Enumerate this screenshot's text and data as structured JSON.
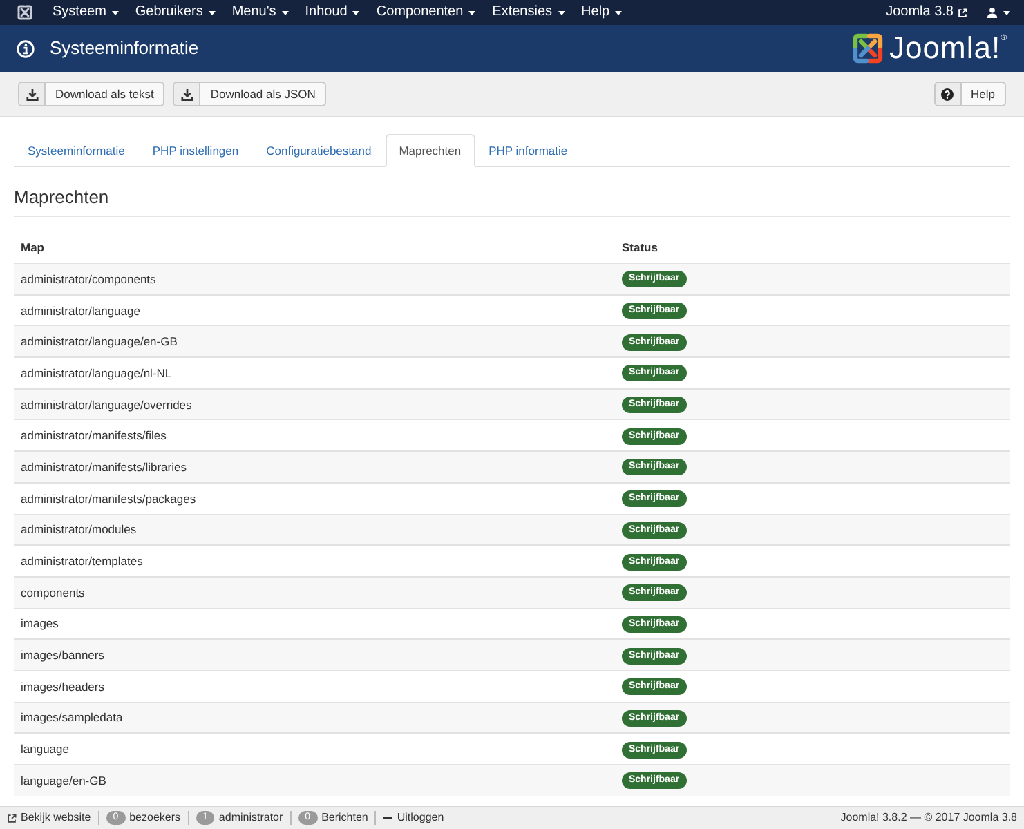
{
  "top_nav": {
    "menus": [
      "Systeem",
      "Gebruikers",
      "Menu's",
      "Inhoud",
      "Componenten",
      "Extensies",
      "Help"
    ],
    "site_link": "Joomla 3.8"
  },
  "header": {
    "title": "Systeeminformatie",
    "logo_text": "Joomla!$^{®}$"
  },
  "toolbar": {
    "buttons": [
      {
        "kind": "download",
        "label": "Download als tekst"
      },
      {
        "kind": "download",
        "label": "Download als JSON"
      },
      {
        "kind": "help",
        "label": "Help"
      }
    ]
  },
  "tabs": [
    {
      "label": "Systeeminformatie",
      "selected": false
    },
    {
      "label": "PHP instellingen",
      "selected": false
    },
    {
      "label": "Configuratiebestand",
      "selected": false
    },
    {
      "label": "Maprechten",
      "selected": true
    },
    {
      "label": "PHP informatie",
      "selected": false
    }
  ],
  "section": {
    "title": "Maprechten"
  },
  "table": {
    "columns": [
      "Map",
      "Status"
    ],
    "rows": [
      {
        "map": "administrator/components",
        "status": "Schrijfbaar",
        "writable": true
      },
      {
        "map": "administrator/language",
        "status": "Schrijfbaar",
        "writable": true
      },
      {
        "map": "administrator/language/en-GB",
        "status": "Schrijfbaar",
        "writable": true
      },
      {
        "map": "administrator/language/nl-NL",
        "status": "Schrijfbaar",
        "writable": true
      },
      {
        "map": "administrator/language/overrides",
        "status": "Schrijfbaar",
        "writable": true
      },
      {
        "map": "administrator/manifests/files",
        "status": "Schrijfbaar",
        "writable": true
      },
      {
        "map": "administrator/manifests/libraries",
        "status": "Schrijfbaar",
        "writable": true
      },
      {
        "map": "administrator/manifests/packages",
        "status": "Schrijfbaar",
        "writable": true
      },
      {
        "map": "administrator/modules",
        "status": "Schrijfbaar",
        "writable": true
      },
      {
        "map": "administrator/templates",
        "status": "Schrijfbaar",
        "writable": true
      },
      {
        "map": "components",
        "status": "Schrijfbaar",
        "writable": true
      },
      {
        "map": "images",
        "status": "Schrijfbaar",
        "writable": true
      },
      {
        "map": "images/banners",
        "status": "Schrijfbaar",
        "writable": true
      },
      {
        "map": "images/headers",
        "status": "Schrijfbaar",
        "writable": true
      },
      {
        "map": "images/sampledata",
        "status": "Schrijfbaar",
        "writable": true
      },
      {
        "map": "language",
        "status": "Schrijfbaar",
        "writable": true
      },
      {
        "map": "language/en-GB",
        "status": "Schrijfbaar",
        "writable": true
      }
    ]
  },
  "status_bar": {
    "items": [
      {
        "kind": "link",
        "label": "Bekijk website"
      },
      {
        "kind": "count",
        "count": "0",
        "label": "bezoekers"
      },
      {
        "kind": "count",
        "count": "1",
        "label": "administrator"
      },
      {
        "kind": "count",
        "count": "0",
        "label": "Berichten"
      },
      {
        "kind": "logout",
        "label": "Uitloggen"
      }
    ],
    "version": "Joomla! 3.8.2  —  © 2017 Joomla 3.8"
  }
}
